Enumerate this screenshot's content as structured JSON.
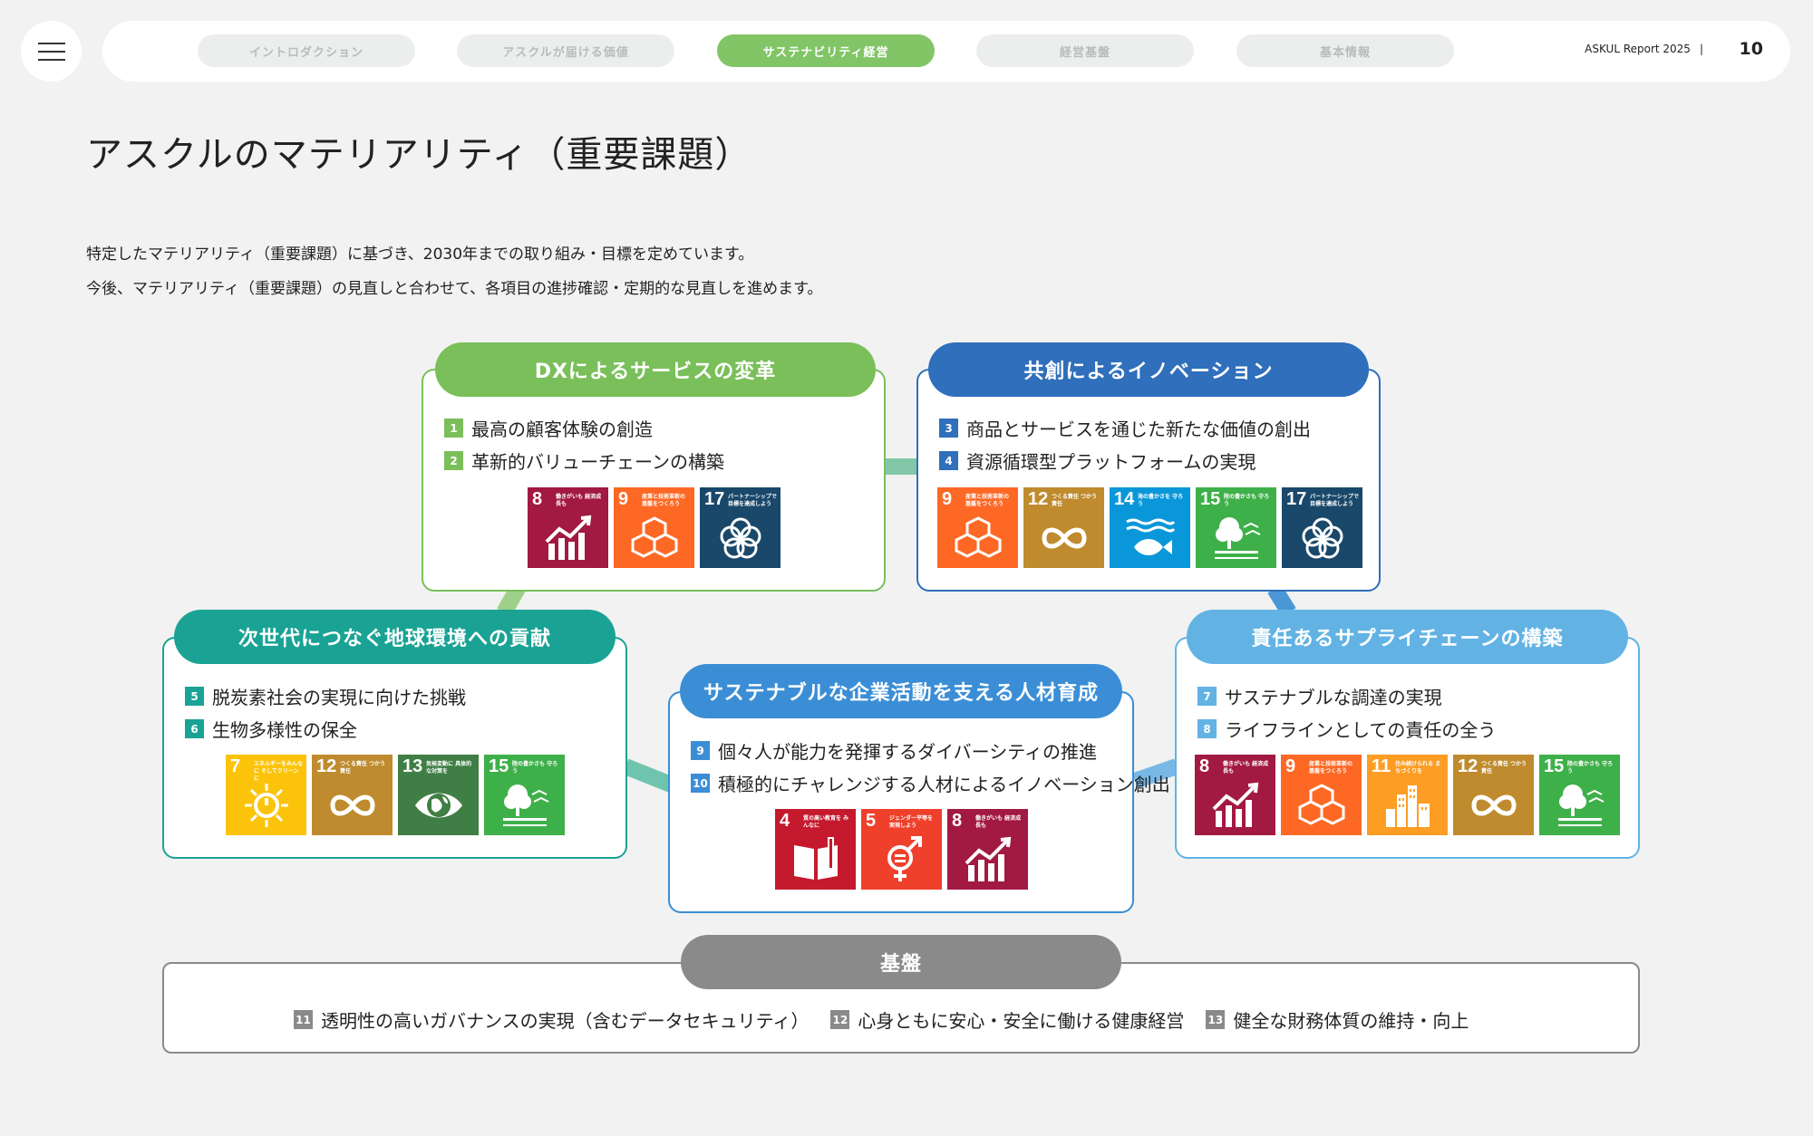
{
  "nav": {
    "tabs": [
      {
        "label": "イントロダクション",
        "active": false
      },
      {
        "label": "アスクルが届ける価値",
        "active": false
      },
      {
        "label": "サステナビリティ経営",
        "active": true
      },
      {
        "label": "経営基盤",
        "active": false
      },
      {
        "label": "基本情報",
        "active": false
      }
    ],
    "report_title": "ASKUL Report 2025",
    "separator": "|",
    "page_number": "10"
  },
  "page_title": "アスクルのマテリアリティ（重要課題）",
  "intro": [
    "特定したマテリアリティ（重要課題）に基づき、2030年までの取り組み・目標を定めています。",
    "今後、マテリアリティ（重要課題）の見直しと合わせて、各項目の進捗確認・定期的な見直しを進めます。"
  ],
  "colors": {
    "dx": "#7abf5a",
    "cocreation": "#2f6fbb",
    "environment": "#1aa394",
    "people": "#3b8ed6",
    "supply": "#62b3e4",
    "base": "#8a8a8a",
    "page_bg": "#f1f2f1"
  },
  "groups": {
    "dx": {
      "title": "DXによるサービスの変革",
      "items": [
        {
          "num": "1",
          "text": "最高の顧客体験の創造"
        },
        {
          "num": "2",
          "text": "革新的バリューチェーンの構築"
        }
      ]
    },
    "cocreation": {
      "title": "共創によるイノベーション",
      "items": [
        {
          "num": "3",
          "text": "商品とサービスを通じた新たな価値の創出"
        },
        {
          "num": "4",
          "text": "資源循環型プラットフォームの実現"
        }
      ]
    },
    "environment": {
      "title": "次世代につなぐ地球環境への貢献",
      "items": [
        {
          "num": "5",
          "text": "脱炭素社会の実現に向けた挑戦"
        },
        {
          "num": "6",
          "text": "生物多様性の保全"
        }
      ]
    },
    "people": {
      "title": "サステナブルな企業活動を支える人材育成",
      "items": [
        {
          "num": "9",
          "text": "個々人が能力を発揮するダイバーシティの推進"
        },
        {
          "num": "10",
          "text": "積極的にチャレンジする人材によるイノベーション創出"
        }
      ]
    },
    "supply": {
      "title": "責任あるサプライチェーンの構築",
      "items": [
        {
          "num": "7",
          "text": "サステナブルな調達の実現"
        },
        {
          "num": "8",
          "text": "ライフラインとしての責任の全う"
        }
      ]
    },
    "base": {
      "title": "基盤",
      "items": [
        {
          "num": "11",
          "text": "透明性の高いガバナンスの実現（含むデータセキュリティ）"
        },
        {
          "num": "12",
          "text": "心身ともに安心・安全に働ける健康経営"
        },
        {
          "num": "13",
          "text": "健全な財務体質の維持・向上"
        }
      ]
    }
  },
  "sdg_icons": {
    "dx": [
      {
        "num": "8",
        "label": "働きがいも 経済成長も",
        "icon": "growth-chart-icon",
        "color": "#a21942"
      },
      {
        "num": "9",
        "label": "産業と技術革新の 基盤をつくろう",
        "icon": "cubes-icon",
        "color": "#fd6925"
      },
      {
        "num": "17",
        "label": "パートナーシップで 目標を達成しよう",
        "icon": "flower-rings-icon",
        "color": "#19486a"
      }
    ],
    "cocreation": [
      {
        "num": "9",
        "label": "産業と技術革新の 基盤をつくろう",
        "icon": "cubes-icon",
        "color": "#fd6925"
      },
      {
        "num": "12",
        "label": "つくる責任 つかう責任",
        "icon": "infinity-icon",
        "color": "#bf8b2e"
      },
      {
        "num": "14",
        "label": "海の豊かさを 守ろう",
        "icon": "fish-icon",
        "color": "#0a97d9"
      },
      {
        "num": "15",
        "label": "陸の豊かさも 守ろう",
        "icon": "tree-icon",
        "color": "#3eb049"
      },
      {
        "num": "17",
        "label": "パートナーシップで 目標を達成しよう",
        "icon": "flower-rings-icon",
        "color": "#19486a"
      }
    ],
    "environment": [
      {
        "num": "7",
        "label": "エネルギーをみんなに そしてクリーンに",
        "icon": "sun-power-icon",
        "color": "#fcc30b"
      },
      {
        "num": "12",
        "label": "つくる責任 つかう責任",
        "icon": "infinity-icon",
        "color": "#bf8b2e"
      },
      {
        "num": "13",
        "label": "気候変動に 具体的な対策を",
        "icon": "eye-globe-icon",
        "color": "#3f7e44"
      },
      {
        "num": "15",
        "label": "陸の豊かさも 守ろう",
        "icon": "tree-icon",
        "color": "#3eb049"
      }
    ],
    "people": [
      {
        "num": "4",
        "label": "質の高い教育を みんなに",
        "icon": "book-icon",
        "color": "#c5192d"
      },
      {
        "num": "5",
        "label": "ジェンダー平等を 実現しよう",
        "icon": "gender-icon",
        "color": "#ef402b"
      },
      {
        "num": "8",
        "label": "働きがいも 経済成長も",
        "icon": "growth-chart-icon",
        "color": "#a21942"
      }
    ],
    "supply": [
      {
        "num": "8",
        "label": "働きがいも 経済成長も",
        "icon": "growth-chart-icon",
        "color": "#a21942"
      },
      {
        "num": "9",
        "label": "産業と技術革新の 基盤をつくろう",
        "icon": "cubes-icon",
        "color": "#fd6925"
      },
      {
        "num": "11",
        "label": "住み続けられる まちづくりを",
        "icon": "city-icon",
        "color": "#fd9d24"
      },
      {
        "num": "12",
        "label": "つくる責任 つかう責任",
        "icon": "infinity-icon",
        "color": "#bf8b2e"
      },
      {
        "num": "15",
        "label": "陸の豊かさも 守ろう",
        "icon": "tree-icon",
        "color": "#3eb049"
      }
    ]
  }
}
